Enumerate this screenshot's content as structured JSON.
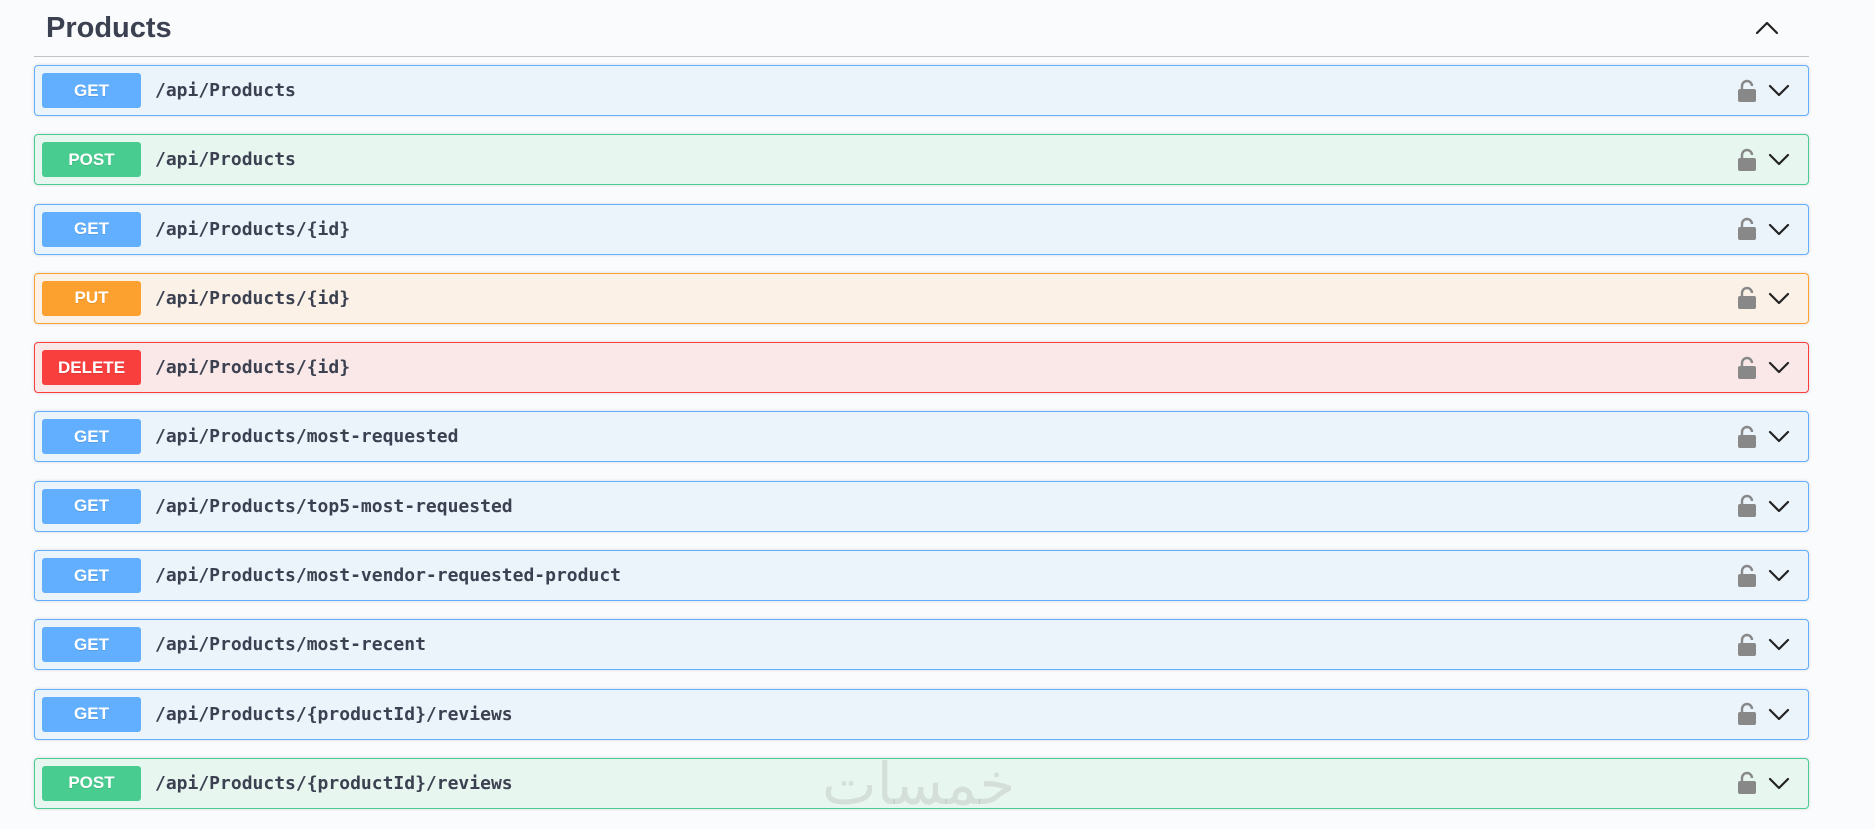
{
  "section": {
    "title": "Products"
  },
  "operations": [
    {
      "method": "GET",
      "path": "/api/Products"
    },
    {
      "method": "POST",
      "path": "/api/Products"
    },
    {
      "method": "GET",
      "path": "/api/Products/{id}"
    },
    {
      "method": "PUT",
      "path": "/api/Products/{id}"
    },
    {
      "method": "DELETE",
      "path": "/api/Products/{id}"
    },
    {
      "method": "GET",
      "path": "/api/Products/most-requested"
    },
    {
      "method": "GET",
      "path": "/api/Products/top5-most-requested"
    },
    {
      "method": "GET",
      "path": "/api/Products/most-vendor-requested-product"
    },
    {
      "method": "GET",
      "path": "/api/Products/most-recent"
    },
    {
      "method": "GET",
      "path": "/api/Products/{productId}/reviews"
    },
    {
      "method": "POST",
      "path": "/api/Products/{productId}/reviews"
    }
  ],
  "icons": {
    "collapse": "chevron-up-icon",
    "lock": "lock-icon",
    "expand": "chevron-down-icon"
  },
  "colors": {
    "get": "#61affe",
    "post": "#49cc90",
    "put": "#fca130",
    "delete": "#f93e3e",
    "text": "#3b4151"
  },
  "watermark": "خمسات"
}
